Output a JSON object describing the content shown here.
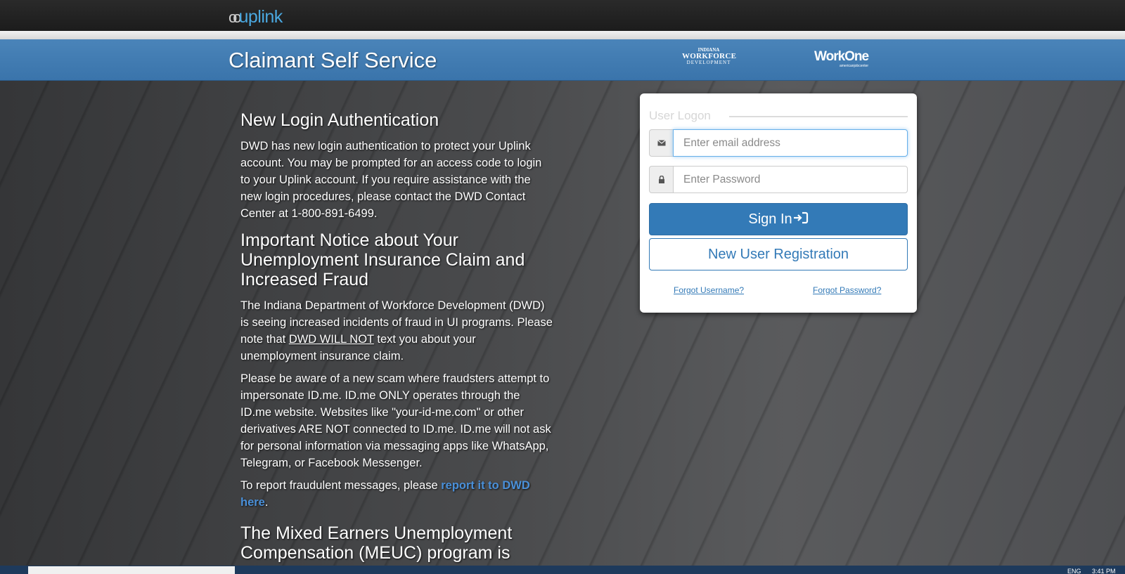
{
  "header": {
    "logo_prefix": "oo",
    "logo_text": "uplink"
  },
  "banner": {
    "title": "Claimant Self Service",
    "iwd_logo": {
      "line1": "INDIANA",
      "line2": "WORKFORCE",
      "line3": "DEVELOPMENT"
    },
    "workone_logo": {
      "name": "WorkOne",
      "sub": "americanjobcenter"
    }
  },
  "content": {
    "section1_title": "New Login Authentication",
    "section1_text": "DWD has new login authentication to protect your Uplink account. You may be prompted for an access code to login to your Uplink account. If you require assistance with the new login procedures, please contact the DWD Contact Center at 1-800-891-6499.",
    "section2_title": "Important Notice about Your Unemployment Insurance Claim and Increased Fraud",
    "section2_p1_a": "The Indiana Department of Workforce Development (DWD) is seeing increased incidents of fraud in UI programs. Please note that ",
    "section2_p1_u": "DWD WILL NOT",
    "section2_p1_b": " text you about your unemployment insurance claim.",
    "section2_p2": "Please be aware of a new scam where fraudsters attempt to impersonate ID.me. ID.me ONLY operates through the ID.me website. Websites like \"your-id-me.com\" or other derivatives ARE NOT connected to ID.me. ID.me will not ask for personal information via messaging apps like WhatsApp, Telegram, or Facebook Messenger.",
    "section2_p3_a": "To report fraudulent messages, please ",
    "section2_p3_link": "report it to DWD here",
    "section2_p3_b": ".",
    "section3_title": "The Mixed Earners Unemployment Compensation (MEUC) program is"
  },
  "login": {
    "legend": "User Logon",
    "email_placeholder": "Enter email address",
    "password_placeholder": "Enter Password",
    "email_icon": "envelope-icon",
    "password_icon": "lock-icon",
    "sign_in_label": "Sign In",
    "sign_in_icon": "log-in-icon",
    "register_label": "New User Registration",
    "forgot_username": "Forgot Username?",
    "forgot_password": "Forgot Password?"
  },
  "taskbar": {
    "lang": "ENG",
    "time": "3:41 PM"
  },
  "colors": {
    "banner_blue": "#4a84b9",
    "primary": "#337ab7",
    "link": "#4a90d9"
  }
}
